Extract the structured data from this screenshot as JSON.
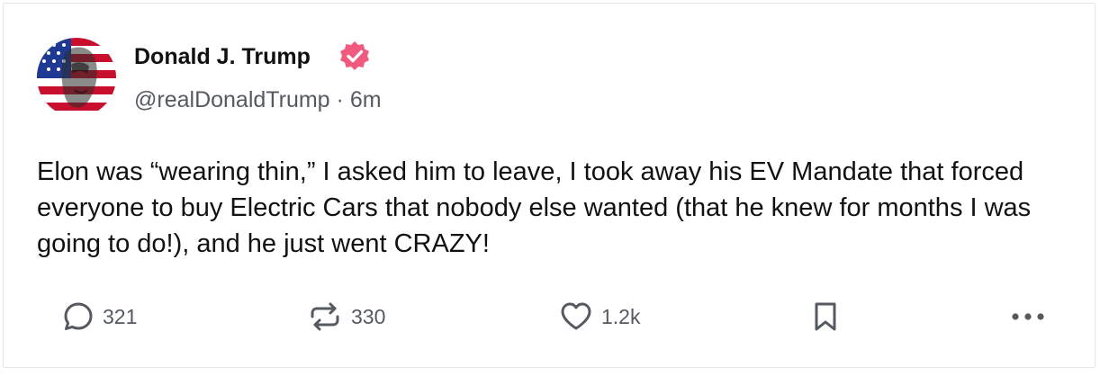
{
  "post": {
    "author": {
      "name": "Donald J. Trump",
      "handle": "@realDonaldTrump",
      "separator": "·",
      "time": "6m",
      "verified_icon": "verified-badge-icon",
      "verified_color": "#f05a7e"
    },
    "body": "Elon was “wearing thin,” I asked him to leave, I took away his EV Mandate that forced everyone to buy Electric Cars that nobody else wanted (that he knew for months I was going to do!), and he just went CRAZY!",
    "actions": {
      "reply": {
        "icon": "reply-bubble-icon",
        "count": "321"
      },
      "repost": {
        "icon": "repost-arrows-icon",
        "count": "330"
      },
      "like": {
        "icon": "heart-icon",
        "count": "1.2k"
      },
      "bookmark": {
        "icon": "bookmark-icon"
      },
      "more": {
        "icon": "more-dots-icon"
      }
    }
  },
  "colors": {
    "text": "#111111",
    "secondary_text": "#555a61",
    "border": "#e6e6e6",
    "flag_red": "#c8102e",
    "flag_blue": "#1f3a93"
  }
}
